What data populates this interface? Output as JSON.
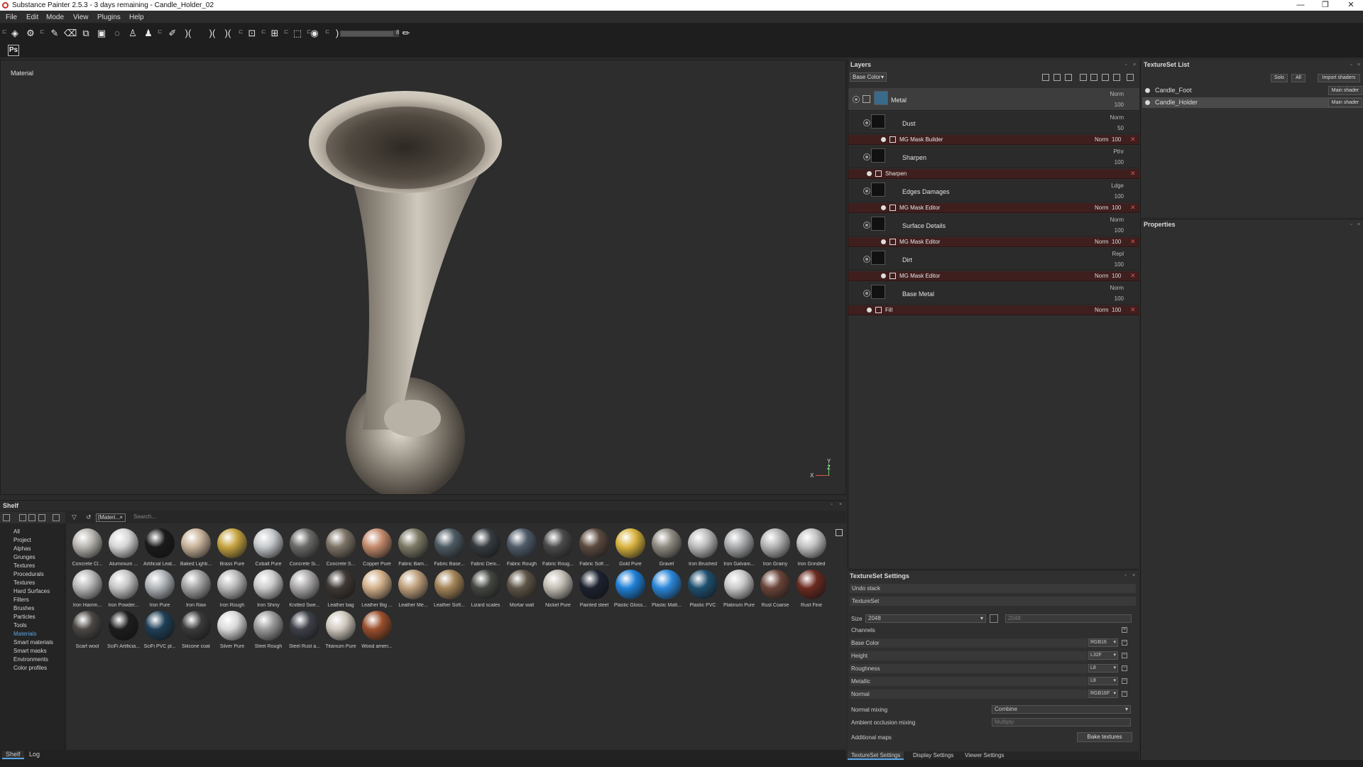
{
  "window": {
    "title": "Substance Painter 2.5.3 - 3 days remaining - Candle_Holder_02",
    "controls": [
      "—",
      "❐",
      "✕"
    ]
  },
  "menu": [
    "File",
    "Edit",
    "Mode",
    "View",
    "Plugins",
    "Help"
  ],
  "toolbar": {
    "brush_size_value": "8",
    "ps_label": "Ps",
    "brush_size_fraction": 0.91
  },
  "viewport": {
    "label": "Material",
    "axis_y": "Y",
    "axis_z": "Z",
    "axis_x": "X"
  },
  "shelf": {
    "title": "Shelf",
    "categories": [
      "All",
      "Project",
      "Alphas",
      "Grunges",
      "Textures",
      "Procedurals",
      "Textures",
      "Hard Surfaces",
      "Filters",
      "Brushes",
      "Particles",
      "Tools",
      "Materials",
      "Smart materials",
      "Smart masks",
      "Environments",
      "Color profiles"
    ],
    "active_category": "Materials",
    "filter_chip": "[Materi...",
    "search_placeholder": "Search...",
    "materials": [
      {
        "name": "Concrete Cl...",
        "color": "#b9b6b0"
      },
      {
        "name": "Aluminium ...",
        "color": "#d6d6d6"
      },
      {
        "name": "Artificial Leat...",
        "color": "#1a1a1a"
      },
      {
        "name": "Baked Lighti...",
        "color": "#c8b29a"
      },
      {
        "name": "Brass Pure",
        "color": "#c7a441"
      },
      {
        "name": "Cobalt Pure",
        "color": "#c5c8cc"
      },
      {
        "name": "Concrete Si...",
        "color": "#6a6a68"
      },
      {
        "name": "Concrete S...",
        "color": "#7c7366"
      },
      {
        "name": "Copper Pure",
        "color": "#c48a6c"
      },
      {
        "name": "Fabric Bam...",
        "color": "#7d7a66"
      },
      {
        "name": "Fabric Base...",
        "color": "#4d5a62"
      },
      {
        "name": "Fabric Deni...",
        "color": "#353b40"
      },
      {
        "name": "Fabric Rough",
        "color": "#4e5b69"
      },
      {
        "name": "Fabric Roug...",
        "color": "#4a4a4a"
      },
      {
        "name": "Fabric Soft ...",
        "color": "#5b4a3f"
      },
      {
        "name": "Gold Pure",
        "color": "#d8b33e"
      },
      {
        "name": "Gravel",
        "color": "#8f8b82"
      },
      {
        "name": "Iron Brushed",
        "color": "#bcbcbc"
      },
      {
        "name": "Iron Galvani...",
        "color": "#a9abad"
      },
      {
        "name": "Iron Grainy",
        "color": "#b3b3b3"
      },
      {
        "name": "Iron Grinded",
        "color": "#c2c2c2"
      },
      {
        "name": "Iron Hamm...",
        "color": "#b8b8b8"
      },
      {
        "name": "Iron Powder...",
        "color": "#c6c6c6"
      },
      {
        "name": "Iron Pure",
        "color": "#b0b4b8"
      },
      {
        "name": "Iron Raw",
        "color": "#a3a3a3"
      },
      {
        "name": "Iron Rough",
        "color": "#b9b9b9"
      },
      {
        "name": "Iron Shiny",
        "color": "#cbcbcb"
      },
      {
        "name": "Knitted Swe...",
        "color": "#aaa8a8"
      },
      {
        "name": "Leather bag",
        "color": "#3f3833"
      },
      {
        "name": "Leather Big ...",
        "color": "#d3b08a"
      },
      {
        "name": "Leather Me...",
        "color": "#bfa07c"
      },
      {
        "name": "Leather Soft...",
        "color": "#a48457"
      },
      {
        "name": "Lizard scales",
        "color": "#434740"
      },
      {
        "name": "Mortar wall",
        "color": "#5e5446"
      },
      {
        "name": "Nickel Pure",
        "color": "#c2bdb4"
      },
      {
        "name": "Painted steel",
        "color": "#1c2130"
      },
      {
        "name": "Plastic Gloss...",
        "color": "#1e7fd6"
      },
      {
        "name": "Plastic Matt...",
        "color": "#2a86d9"
      },
      {
        "name": "Plastic PVC",
        "color": "#1e4e6e"
      },
      {
        "name": "Platinum Pure",
        "color": "#c9c9c9"
      },
      {
        "name": "Rust Coarse",
        "color": "#6a4438"
      },
      {
        "name": "Rust Fine",
        "color": "#6b2a20"
      },
      {
        "name": "Scarf wool",
        "color": "#4a4744"
      },
      {
        "name": "SciFi Artificia...",
        "color": "#1d1d1d"
      },
      {
        "name": "SciFi PVC pl...",
        "color": "#1e3f56"
      },
      {
        "name": "Silicone coat",
        "color": "#3a3a3a"
      },
      {
        "name": "Silver Pure",
        "color": "#d9d9d9"
      },
      {
        "name": "Steel Rough",
        "color": "#9a9a9a"
      },
      {
        "name": "Steel Rust a...",
        "color": "#3d4048"
      },
      {
        "name": "Titanium Pure",
        "color": "#cfc8bd"
      },
      {
        "name": "Wood ameri...",
        "color": "#9a4f2c"
      }
    ]
  },
  "bottom_tabs": [
    "Shelf",
    "Log"
  ],
  "layers": {
    "title": "Layers",
    "channel": "Base Color",
    "rows": [
      {
        "kind": "layer",
        "name": "Metal",
        "blend": "Norm",
        "opacity": "100",
        "selected": true
      },
      {
        "kind": "layer",
        "name": "Dust",
        "blend": "Norm",
        "opacity": "50"
      },
      {
        "kind": "mask",
        "name": "MG Mask Builder",
        "blend": "Norm",
        "opacity": "100"
      },
      {
        "kind": "layer",
        "name": "Sharpen",
        "blend": "Pthr",
        "opacity": "100"
      },
      {
        "kind": "mask",
        "name": "Sharpen",
        "blend": "",
        "opacity": ""
      },
      {
        "kind": "layer",
        "name": "Edges Damages",
        "blend": "Ldge",
        "opacity": "100"
      },
      {
        "kind": "mask",
        "name": "MG Mask Editor",
        "blend": "Norm",
        "opacity": "100"
      },
      {
        "kind": "layer",
        "name": "Surface Details",
        "blend": "Norm",
        "opacity": "100"
      },
      {
        "kind": "mask",
        "name": "MG Mask Editor",
        "blend": "Norm",
        "opacity": "100"
      },
      {
        "kind": "layer",
        "name": "Dirt",
        "blend": "Repl",
        "opacity": "100"
      },
      {
        "kind": "mask",
        "name": "MG Mask Editor",
        "blend": "Norm",
        "opacity": "100"
      },
      {
        "kind": "layer",
        "name": "Base Metal",
        "blend": "Norm",
        "opacity": "100"
      },
      {
        "kind": "mask",
        "name": "Fill",
        "blend": "Norm",
        "opacity": "100"
      }
    ]
  },
  "texture_set_list": {
    "title": "TextureSet List",
    "buttons": [
      "Solo",
      "All",
      "Import shaders"
    ],
    "sets": [
      {
        "name": "Candle_Foot",
        "shader": "Main shader",
        "selected": false
      },
      {
        "name": "Candle_Holder",
        "shader": "Main shader",
        "selected": true
      }
    ]
  },
  "properties": {
    "title": "Properties"
  },
  "texture_set_settings": {
    "title": "TextureSet Settings",
    "undo_stack": "Undo stack",
    "textureset_label": "TextureSet",
    "size_label": "Size",
    "size_value": "2048",
    "size_value2": "2048",
    "channels_label": "Channels",
    "channels": [
      {
        "name": "Base Color",
        "format": "RGB16"
      },
      {
        "name": "Height",
        "format": "L32F"
      },
      {
        "name": "Roughness",
        "format": "L8"
      },
      {
        "name": "Metallic",
        "format": "L8"
      },
      {
        "name": "Normal",
        "format": "RGB16F"
      }
    ],
    "normal_mixing_label": "Normal mixing",
    "normal_mixing_value": "Combine",
    "ao_mixing_label": "Ambient occlusion mixing",
    "ao_mixing_value": "Multiply",
    "additional_maps_label": "Additional maps",
    "bake_button": "Bake textures",
    "tabs": [
      "TextureSet Settings",
      "Display Settings",
      "Viewer Settings"
    ]
  },
  "colors": {
    "accent": "#5aa6e6",
    "mask_row": "#3f1e1e",
    "remove": "#e05050"
  }
}
